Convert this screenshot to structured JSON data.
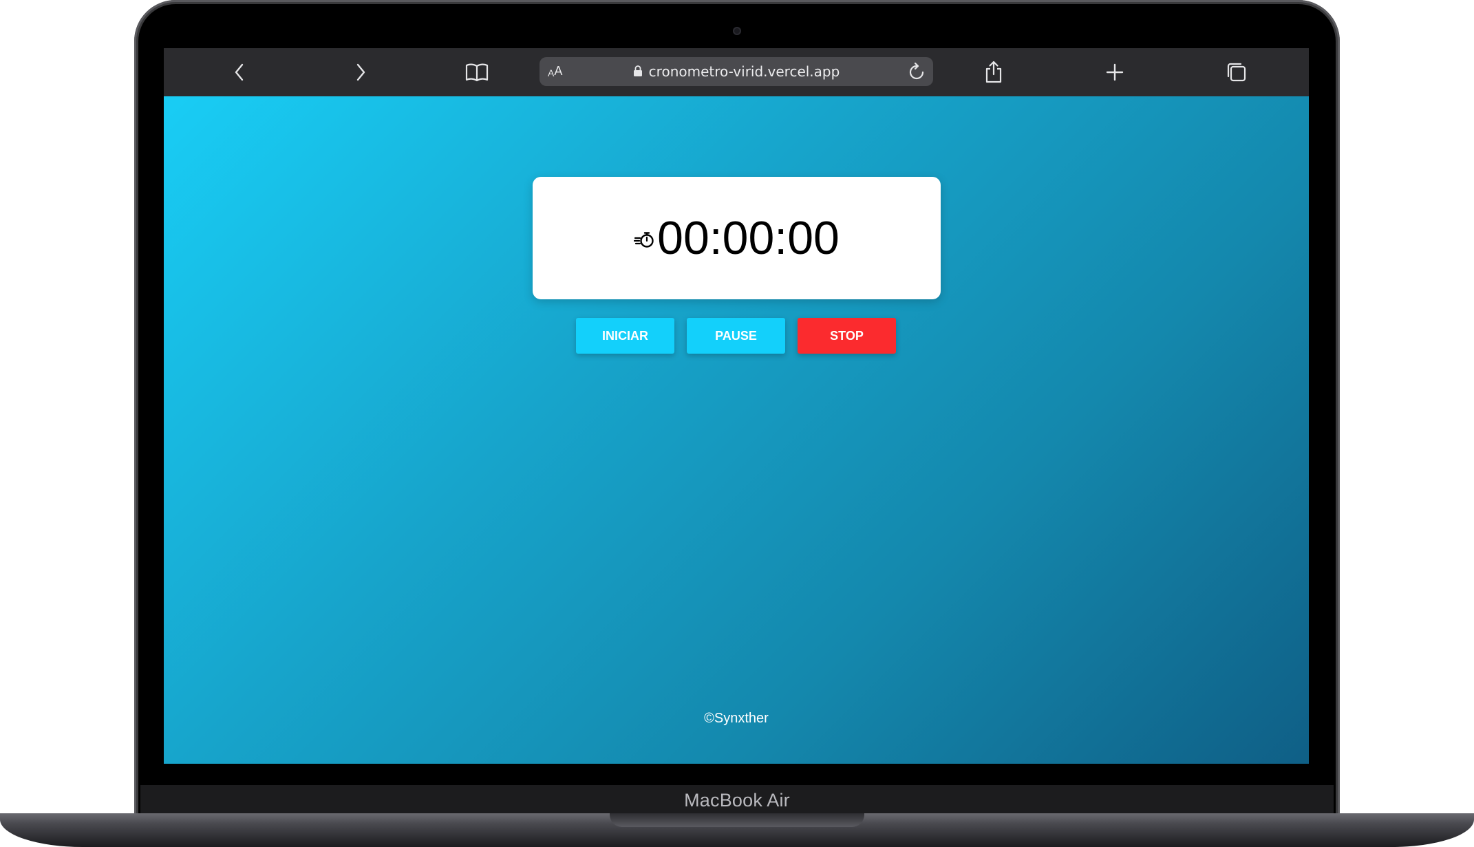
{
  "device": {
    "brand_label": "MacBook Air"
  },
  "browser": {
    "reader_small": "A",
    "reader_big": "A",
    "url": "cronometro-virid.vercel.app",
    "icons": {
      "back": "chevron-left-icon",
      "forward": "chevron-right-icon",
      "bookmarks": "book-icon",
      "lock": "lock-icon",
      "reload": "reload-icon",
      "share": "share-icon",
      "new_tab": "plus-icon",
      "tabs": "tabs-icon"
    }
  },
  "app": {
    "time": "00:00:00",
    "stopwatch_icon": "stopwatch-icon",
    "buttons": {
      "start": "INICIAR",
      "pause": "PAUSE",
      "stop": "STOP"
    },
    "footer": "©Synxther"
  },
  "colors": {
    "gradient_start": "#19cdf5",
    "gradient_end": "#0f5f86",
    "button_blue": "#13d0fb",
    "button_red": "#fb2b2e",
    "toolbar": "#2b2b2e"
  }
}
